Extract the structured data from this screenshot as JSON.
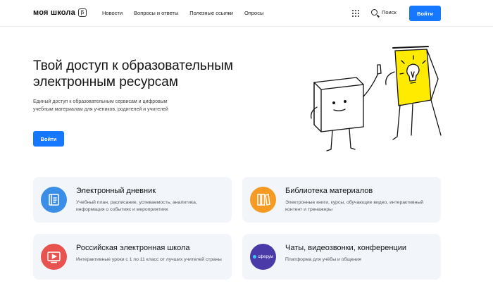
{
  "header": {
    "logo_text": "моя школа",
    "beta_mark": "β",
    "nav": [
      "Новости",
      "Вопросы и ответы",
      "Полезные ссылки",
      "Опросы"
    ],
    "search_label": "Поиск",
    "login_label": "Войти"
  },
  "hero": {
    "title": "Твой доступ к образовательным электронным ресурсам",
    "subtitle": "Единый доступ к образовательным сервисам и цифровым учебным материалам для учеников, родителей и учителей",
    "login_label": "Войти"
  },
  "cards": [
    {
      "title": "Электронный дневник",
      "desc": "Учебный план, расписание, успеваемость, аналитика, информация о событиях и мероприятиях",
      "icon": "diary-icon",
      "color": "#3a8ee6"
    },
    {
      "title": "Библиотека материалов",
      "desc": "Электронные книги, курсы, обучающие видео, интерактивный контент и тренажеры",
      "icon": "library-icon",
      "color": "#f59a23"
    },
    {
      "title": "Российская электронная школа",
      "desc": "Интерактивные уроки с 1 по 11 класс от лучших учителей страны",
      "icon": "video-lesson-icon",
      "color": "#e8534f"
    },
    {
      "title": "Чаты, видеозвонки, конференции",
      "desc": "Платформа для учёбы и общения",
      "icon": "sferum-icon",
      "icon_text": "сферум",
      "color": "#4a3aa8"
    }
  ],
  "colors": {
    "accent": "#1677ff",
    "card_bg": "#f2f6fb",
    "illustration_yellow": "#ffeb00"
  }
}
